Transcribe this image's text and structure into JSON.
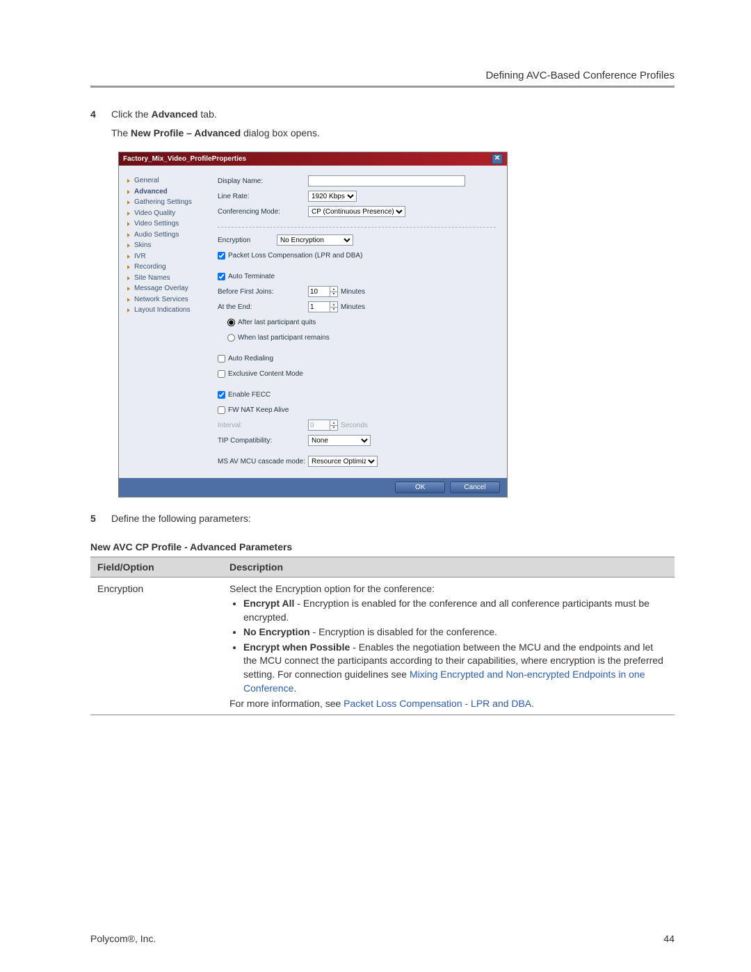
{
  "header": {
    "section_title": "Defining AVC-Based Conference Profiles"
  },
  "steps": {
    "s4": {
      "num": "4",
      "text_a": "Click the ",
      "bold1": "Advanced",
      "text_b": " tab."
    },
    "s4_sub_a": "The ",
    "s4_sub_bold": "New Profile – Advanced",
    "s4_sub_b": " dialog box opens.",
    "s5": {
      "num": "5",
      "text": "Define the following parameters:"
    }
  },
  "dialog": {
    "title": "Factory_Mix_Video_ProfileProperties",
    "close": "✕",
    "sidebar": [
      "General",
      "Advanced",
      "Gathering Settings",
      "Video Quality",
      "Video Settings",
      "Audio Settings",
      "Skins",
      "IVR",
      "Recording",
      "Site Names",
      "Message Overlay",
      "Network Services",
      "Layout Indications"
    ],
    "active_index": 1,
    "top": {
      "display_name_label": "Display Name:",
      "display_name_value": "",
      "line_rate_label": "Line Rate:",
      "line_rate_value": "1920 Kbps",
      "conf_mode_label": "Conferencing Mode:",
      "conf_mode_value": "CP (Continuous Presence)"
    },
    "fields": {
      "encryption_label": "Encryption",
      "encryption_value": "No Encryption",
      "plc_label": "Packet Loss Compensation (LPR and DBA)",
      "plc_checked": true,
      "autoterm_label": "Auto Terminate",
      "autoterm_checked": true,
      "before_label": "Before First Joins:",
      "before_value": "10",
      "before_unit": "Minutes",
      "atend_label": "At the End:",
      "atend_value": "1",
      "atend_unit": "Minutes",
      "radio_after_label": "After last participant quits",
      "radio_when_label": "When last participant remains",
      "radio_selected": "after",
      "autoredial_label": "Auto Redialing",
      "autoredial_checked": false,
      "exclusive_label": "Exclusive Content Mode",
      "exclusive_checked": false,
      "fecc_label": "Enable FECC",
      "fecc_checked": true,
      "fwnat_label": "FW NAT Keep Alive",
      "fwnat_checked": false,
      "interval_label": "Interval:",
      "interval_value": "0",
      "interval_unit": "Seconds",
      "tip_label": "TIP Compatibility:",
      "tip_value": "None",
      "msav_label": "MS AV MCU cascade mode:",
      "msav_value": "Resource Optimized"
    },
    "buttons": {
      "ok": "OK",
      "cancel": "Cancel"
    }
  },
  "table": {
    "title": "New AVC CP Profile - Advanced Parameters",
    "head_field": "Field/Option",
    "head_desc": "Description",
    "row1": {
      "field": "Encryption",
      "intro": "Select the Encryption option for the conference:",
      "b1_strong": "Encrypt All",
      "b1_rest": " - Encryption is enabled for the conference and all conference participants must be encrypted.",
      "b2_strong": "No Encryption",
      "b2_rest": " - Encryption is disabled for the conference.",
      "b3_strong": "Encrypt when Possible",
      "b3_rest_a": " - Enables the negotiation between the MCU and the endpoints and let the MCU connect the participants according to their capabilities, where encryption is the preferred setting. For connection guidelines see ",
      "b3_link": "Mixing Encrypted and Non-encrypted Endpoints in one Conference",
      "b3_rest_b": ".",
      "more_a": "For more information, see ",
      "more_link": "Packet Loss Compensation - LPR and DBA",
      "more_b": "."
    }
  },
  "footer": {
    "left": "Polycom®, Inc.",
    "right": "44"
  }
}
